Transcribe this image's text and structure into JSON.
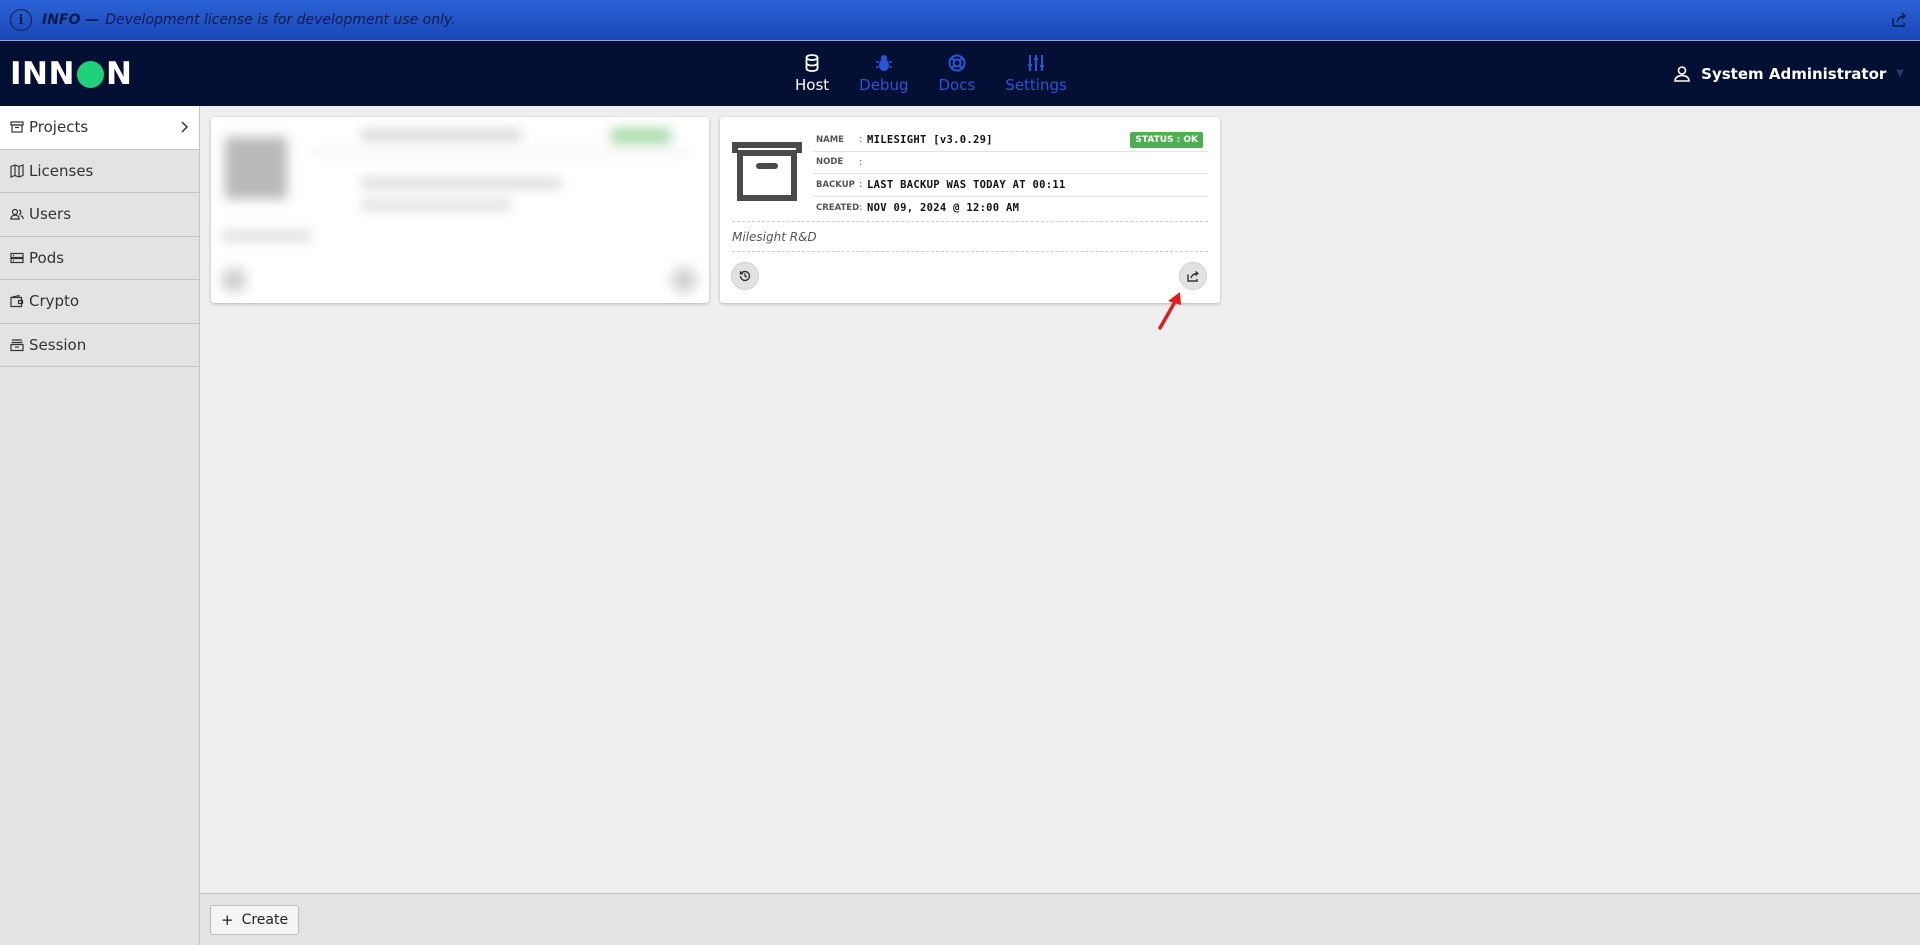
{
  "banner": {
    "title": "INFO —",
    "message": "Development license is for development use only.",
    "color": "#1f4fc4"
  },
  "header": {
    "logo_left": "INN",
    "logo_right": "N",
    "nav": [
      {
        "label": "Host",
        "icon": "database-icon",
        "active": true
      },
      {
        "label": "Debug",
        "icon": "bug-icon",
        "active": false
      },
      {
        "label": "Docs",
        "icon": "lifebuoy-icon",
        "active": false
      },
      {
        "label": "Settings",
        "icon": "sliders-icon",
        "active": false
      }
    ],
    "user": {
      "name": "System Administrator",
      "icon": "user-icon"
    }
  },
  "sidebar": {
    "items": [
      {
        "label": "Projects",
        "icon": "archive-icon",
        "active": true
      },
      {
        "label": "Licenses",
        "icon": "map-icon",
        "active": false
      },
      {
        "label": "Users",
        "icon": "users-icon",
        "active": false
      },
      {
        "label": "Pods",
        "icon": "server-icon",
        "active": false
      },
      {
        "label": "Crypto",
        "icon": "wallet-icon",
        "active": false
      },
      {
        "label": "Session",
        "icon": "stack-icon",
        "active": false
      }
    ]
  },
  "project_card": {
    "fields": [
      {
        "label": "NAME",
        "value": "MILESIGHT [v3.0.29]"
      },
      {
        "label": "NODE",
        "value": ""
      },
      {
        "label": "BACKUP",
        "value": "LAST BACKUP WAS TODAY AT 00:11"
      },
      {
        "label": "CREATED",
        "value": "NOV 09, 2024 @ 12:00 AM"
      }
    ],
    "status": "STATUS : OK",
    "status_color": "#4caf50",
    "description": "Milesight R&D"
  },
  "footer": {
    "create_label": "Create"
  }
}
